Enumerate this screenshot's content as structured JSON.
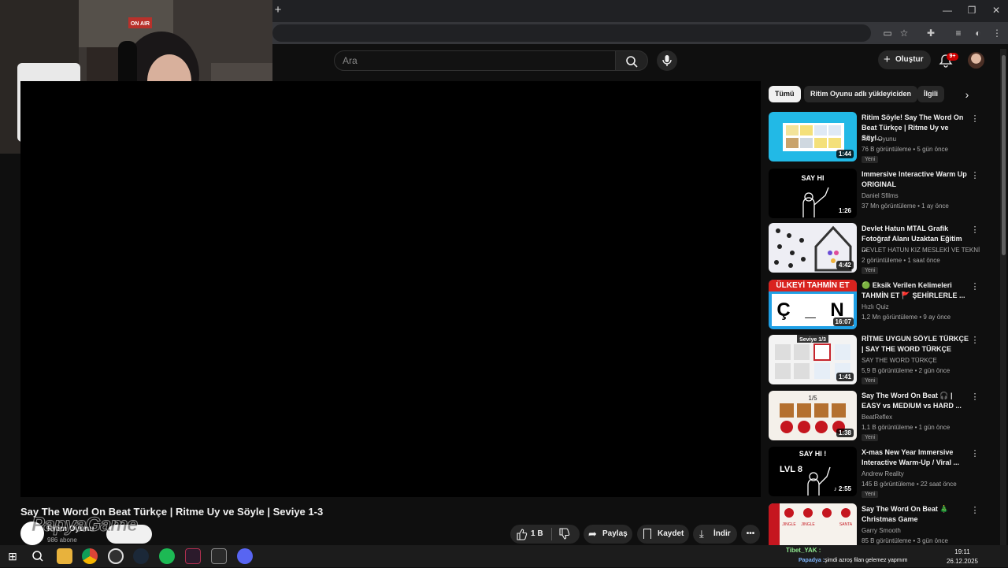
{
  "browser": {
    "new_tab_icon": "plus-icon",
    "window_controls": [
      "minimize-icon",
      "restore-icon",
      "close-icon"
    ],
    "toolbar_icons": [
      "cast-icon",
      "star-icon",
      "extensions-icon",
      "media-icon",
      "profile-icon",
      "menu-icon"
    ]
  },
  "webcam": {
    "sign_text": "ON AIR"
  },
  "header": {
    "search_placeholder": "Ara",
    "create_label": "Oluştur",
    "notifications_badge": "9+"
  },
  "video": {
    "title": "Say The Word On Beat Türkçe | Ritme Uy ve Söyle | Seviye 1-3",
    "channel_name": "Ritim Oyunu",
    "subscribers": "986 abone",
    "watermark": "PapyaGame",
    "likes": "1 B",
    "share_label": "Paylaş",
    "save_label": "Kaydet",
    "download_label": "İndir",
    "more_label": "•••"
  },
  "chips": {
    "items": [
      "Tümü",
      "Ritim Oyunu adlı yükleyiciden",
      "İlgili"
    ],
    "next_icon": "chevron-right-icon"
  },
  "suggestions": [
    {
      "title": "Ritim Söyle! Say The Word On Beat Türkçe | Ritme Uy ve Söyl...",
      "channel": "Ritim Oyunu",
      "meta": "76 B görüntüleme • 5 gün önce",
      "badge": "Yeni",
      "duration": "1:44",
      "color": "#22b9e6"
    },
    {
      "title": "Immersive Interactive Warm Up ORIGINAL",
      "channel": "Daniel Sfilms",
      "meta": "37 Mn görüntüleme • 1 ay önce",
      "badge": "",
      "duration": "1:26",
      "color": "#000000"
    },
    {
      "title": "Devlet Hatun MTAL Grafik Fotoğraf Alanı Uzaktan Eğitim ...",
      "channel": "DEVLET HATUN KIZ MESLEKİ VE TEKNİ...",
      "meta": "2 görüntüleme • 1 saat önce",
      "badge": "Yeni",
      "duration": "4:42",
      "color": "#eeeef4"
    },
    {
      "title": "🟢 Eksik Verilen Kelimeleri TAHMİN ET 🚩 ŞEHİRLERLE ...",
      "channel": "Hızlı Quiz",
      "meta": "1,2 Mn görüntüleme • 9 ay önce",
      "badge": "",
      "duration": "16:07",
      "color": "#1fa0e6",
      "banner": "ÜLKEYİ TAHMİN ET",
      "letters": "Ç _ N"
    },
    {
      "title": "RİTME UYGUN SÖYLE TÜRKÇE | SAY THE WORD TÜRKÇE",
      "channel": "SAY THE WORD TÜRKÇE",
      "meta": "5,9 B görüntüleme • 2 gün önce",
      "badge": "Yeni",
      "duration": "1:41",
      "color": "#f3f3f3"
    },
    {
      "title": "Say The Word On Beat 🎧 | EASY vs MEDIUM vs HARD ...",
      "channel": "BeatReflex",
      "meta": "1,1 B görüntüleme • 1 gün önce",
      "badge": "Yeni",
      "duration": "1:38",
      "color": "#f4f0ea"
    },
    {
      "title": "X-mas New Year Immersive Interactive Warm-Up / Viral ...",
      "channel": "Andrew Reality",
      "meta": "145 B görüntüleme • 22 saat önce",
      "badge": "Yeni",
      "duration": "♪ 2:55",
      "color": "#000000",
      "lvl": "LVL 8"
    },
    {
      "title": "Say The Word On Beat 🎄 Christmas Game",
      "channel": "Garry Smooth",
      "meta": "85 B görüntüleme • 3 gün önce",
      "badge": "",
      "duration": "",
      "color": "#f6f2ec"
    }
  ],
  "thumb_text": {
    "say_hi": "SAY HI",
    "say_hi_excl": "SAY HI !",
    "fraction": "1/5",
    "seviye": "Seviye 1/3",
    "christmas": [
      "JINGLE",
      "JINGLE",
      "SANTA"
    ]
  },
  "taskbar": {
    "apps": [
      "windows-start-icon",
      "search-icon",
      "file-explorer-icon",
      "chrome-icon",
      "obs-icon",
      "steam-icon",
      "spotify-icon",
      "app-icon",
      "epic-games-icon",
      "discord-icon"
    ],
    "time": "19:11",
    "date": "26.12.2025"
  },
  "chat": {
    "user": "Tibet_YAK :",
    "line_name": "Papadya :",
    "line_msg": "şimdi azroş filan gelemez yapmım"
  }
}
